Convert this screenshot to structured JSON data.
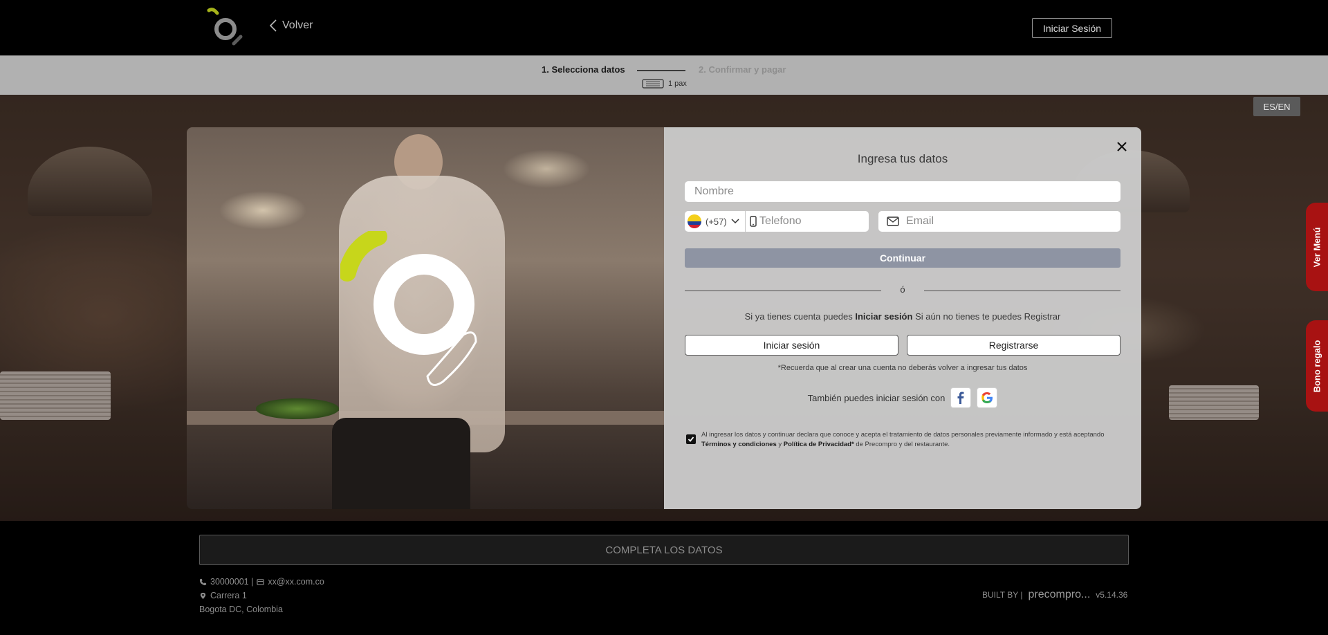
{
  "header": {
    "back_label": "Volver",
    "login_label": "Iniciar Sesión"
  },
  "steps": {
    "step1": "1. Selecciona datos",
    "step2": "2. Confirmar y pagar",
    "pax": "1 pax"
  },
  "scene": {
    "lang_toggle": "ES/EN",
    "side_menu": "Ver Menú",
    "side_gift": "Bono regalo"
  },
  "modal": {
    "title": "Ingresa tus datos",
    "name_placeholder": "Nombre",
    "country_code": "(+57)",
    "phone_placeholder": "Telefono",
    "email_placeholder": "Email",
    "continue_label": "Continuar",
    "or_label": "ó",
    "account_prefix": "Si ya tienes cuenta puedes",
    "account_login": "Iniciar sesión",
    "account_suffix": "Si aún no tienes te puedes Registrar",
    "login_button": "Iniciar sesión",
    "register_button": "Registrarse",
    "note": "*Recuerda que al crear una cuenta no deberás volver a ingresar tus datos",
    "social_label": "También puedes iniciar sesión con",
    "legal_prefix": "Al ingresar los datos y continuar declara que conoce y acepta el tratamiento de datos personales previamente informado y está aceptando",
    "legal_terms": "Términos y condiciones",
    "legal_and": "y",
    "legal_privacy": "Política de Privacidad*",
    "legal_suffix": "de Precompro y del restaurante.",
    "legal_checked": true
  },
  "footer": {
    "complete_label": "COMPLETA LOS DATOS",
    "phone": "30000001 |",
    "email": "xx@xx.com.co",
    "address": "Carrera 1",
    "city": "Bogota DC, Colombia",
    "built_by": "BUILT BY |",
    "brand": "precompro...",
    "version": "v5.14.36"
  },
  "colors": {
    "logo_accent": "#c7d61b",
    "side_tab": "#a81212",
    "continue_button": "#8e94a3"
  }
}
